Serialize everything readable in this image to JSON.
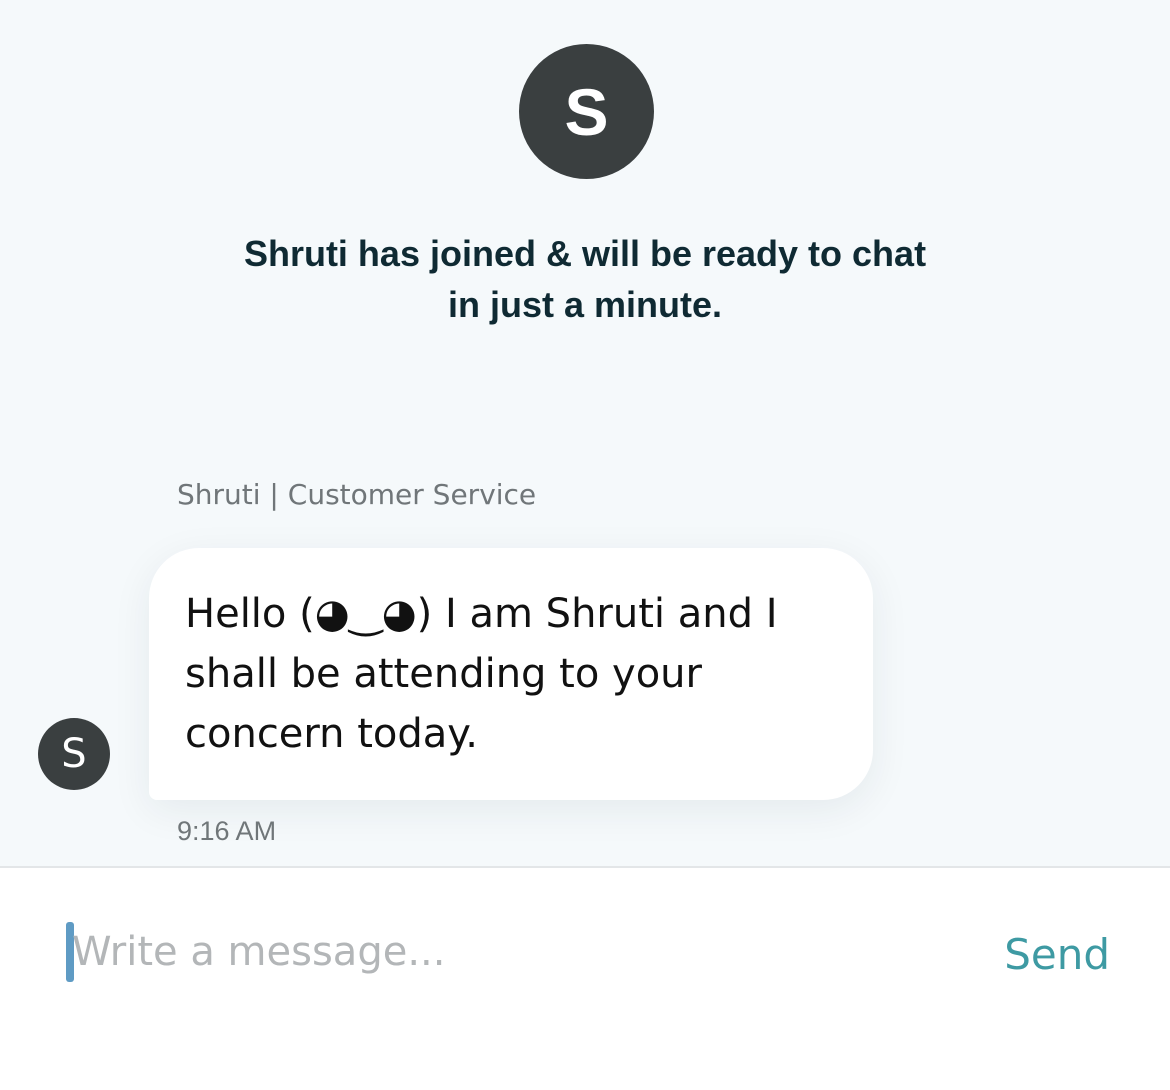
{
  "chat": {
    "agent_initial": "S",
    "join_notice": "Shruti has joined & will be ready to chat in just a minute.",
    "messages": [
      {
        "sender": "Shruti | Customer Service",
        "avatar_initial": "S",
        "text": "Hello (◕‿◕) I am Shruti and I shall be attending to your concern today.",
        "time": "9:16 AM"
      }
    ]
  },
  "composer": {
    "placeholder": "Write a message...",
    "value": "",
    "send_label": "Send"
  },
  "colors": {
    "avatar_bg": "#3a3f40",
    "notice_text": "#0f2a33",
    "send_accent": "#3e9aa3",
    "cursor": "#5f9bc4",
    "chat_bg": "#f5f9fb"
  },
  "icons": {
    "text_cursor": "text-cursor-icon"
  }
}
